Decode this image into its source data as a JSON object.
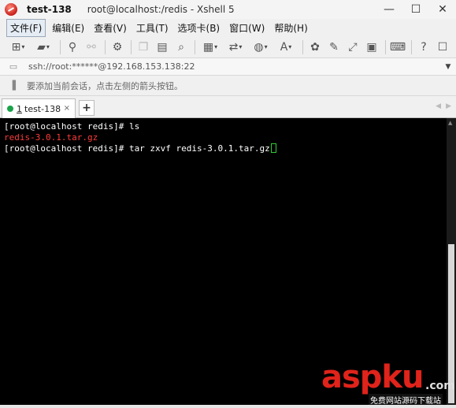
{
  "titlebar": {
    "session": "test-138",
    "title": "root@localhost:/redis - Xshell 5",
    "minimize": "—",
    "maximize": "☐",
    "close": "✕"
  },
  "menu": {
    "items": [
      "文件(F)",
      "编辑(E)",
      "查看(V)",
      "工具(T)",
      "选项卡(B)",
      "窗口(W)",
      "帮助(H)"
    ]
  },
  "address": {
    "value": "ssh://root:******@192.168.153.138:22"
  },
  "hint": {
    "text": "要添加当前会话，点击左侧的箭头按钮。"
  },
  "tabs": {
    "active": {
      "num": "1",
      "label": "test-138"
    },
    "close": "×",
    "add": "+",
    "prev": "◀",
    "next": "▶"
  },
  "terminal": {
    "lines": [
      {
        "text": "[root@localhost redis]# ls",
        "color": "#ffffff"
      },
      {
        "text": "redis-3.0.1.tar.gz",
        "color": "#ff3b3b"
      },
      {
        "text": "[root@localhost redis]# tar zxvf redis-3.0.1.tar.gz",
        "color": "#ffffff"
      }
    ],
    "cursor_color": "#2fd12f"
  },
  "watermark": {
    "main": "aspku",
    "domain": ".com",
    "sub": "免费网站源码下载站"
  },
  "colors": {
    "accent": "#e0231b",
    "terminal_bg": "#000000",
    "session_dot": "#1aa34a"
  },
  "icons": {
    "app": "xshell-logo-icon",
    "new_session": "new-session-icon",
    "open": "open-folder-icon",
    "reconnect": "reconnect-icon",
    "disconnect": "disconnect-icon",
    "properties": "properties-icon",
    "copy": "copy-icon",
    "paste": "paste-icon",
    "find": "find-icon",
    "print": "print-icon",
    "transfer": "transfer-icon",
    "globe": "globe-icon",
    "font": "font-icon",
    "xftp": "xftp-icon",
    "compose": "compose-icon",
    "fullscreen": "fullscreen-icon",
    "lock": "lock-icon",
    "keyboard": "keyboard-icon",
    "help": "help-icon",
    "chat": "chat-icon"
  }
}
